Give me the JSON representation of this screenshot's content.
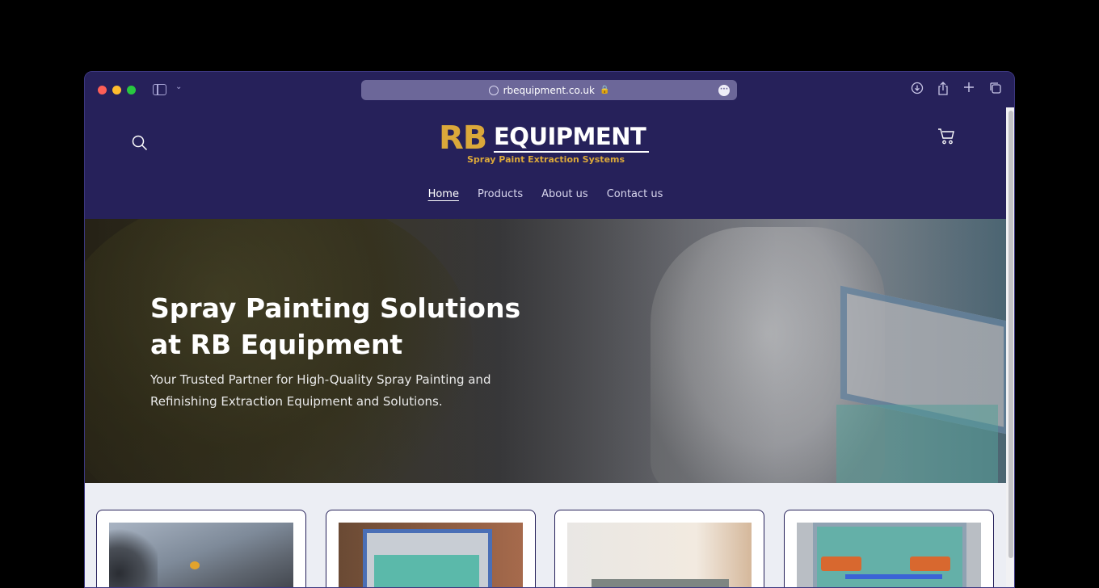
{
  "browser": {
    "url": "rbequipment.co.uk"
  },
  "site": {
    "logo_rb": "RB",
    "logo_equipment": "EQUIPMENT",
    "logo_tagline": "Spray Paint Extraction Systems",
    "nav": [
      {
        "label": "Home",
        "active": true
      },
      {
        "label": "Products"
      },
      {
        "label": "About us"
      },
      {
        "label": "Contact us"
      }
    ]
  },
  "hero": {
    "title": "Spray Painting Solutions at RB Equipment",
    "subtitle": "Your Trusted Partner for High-Quality Spray Painting and Refinishing Extraction Equipment and Solutions."
  },
  "colors": {
    "header_bg": "#26215a",
    "accent_gold": "#dba83a",
    "products_bg": "#eceef4"
  },
  "icons": {
    "search": "search-icon",
    "cart": "cart-icon",
    "download": "download-icon",
    "share": "share-icon",
    "new_tab": "plus-icon",
    "tabs": "tabs-overview-icon"
  }
}
